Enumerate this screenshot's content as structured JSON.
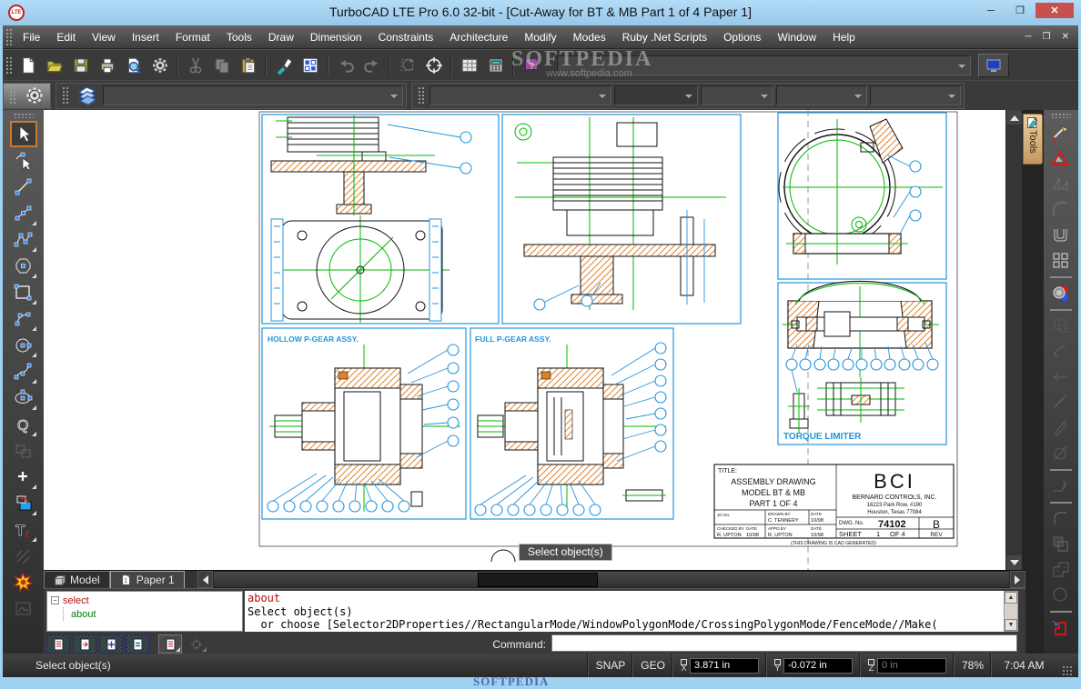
{
  "window": {
    "title": "TurboCAD LTE Pro 6.0 32-bit - [Cut-Away for BT & MB Part 1 of 4 Paper 1]",
    "app_badge": "LTE",
    "controls": {
      "minimize": "─",
      "maximize": "❐",
      "close": "✕"
    }
  },
  "watermark": {
    "line1": "SOFTPEDIA",
    "line2": "www.softpedia.com",
    "bottom": "SOFTPEDIA"
  },
  "menu_bar": {
    "items": [
      "File",
      "Edit",
      "View",
      "Insert",
      "Format",
      "Tools",
      "Draw",
      "Dimension",
      "Constraints",
      "Architecture",
      "Modify",
      "Modes",
      "Ruby .Net Scripts",
      "Options",
      "Window",
      "Help"
    ],
    "mdi_controls": [
      "─",
      "❐",
      "✕"
    ]
  },
  "toolbar_main": {
    "buttons": [
      {
        "name": "new-document"
      },
      {
        "name": "open-file"
      },
      {
        "name": "save"
      },
      {
        "name": "print"
      },
      {
        "name": "print-preview"
      },
      {
        "name": "settings-gear"
      },
      {
        "sep": true
      },
      {
        "name": "cut",
        "disabled": true
      },
      {
        "name": "copy",
        "disabled": true
      },
      {
        "name": "paste"
      },
      {
        "sep": true
      },
      {
        "name": "format-painter"
      },
      {
        "name": "selector-mode"
      },
      {
        "sep": true
      },
      {
        "name": "undo",
        "disabled": true
      },
      {
        "name": "redo",
        "disabled": true
      },
      {
        "sep": true
      },
      {
        "name": "rotate-selector",
        "disabled": true
      },
      {
        "name": "snap-target"
      },
      {
        "sep": true
      },
      {
        "name": "table"
      },
      {
        "name": "calculator"
      },
      {
        "sep": true
      },
      {
        "name": "help-book"
      }
    ],
    "combo_value": ""
  },
  "toolbar_properties": {
    "combos": [
      {
        "name": "layer-combo",
        "value": ""
      },
      {
        "name": "pen-style-combo",
        "value": ""
      },
      {
        "name": "pen-width-combo",
        "value": ""
      },
      {
        "name": "pen-pattern-combo",
        "value": ""
      },
      {
        "name": "brush-style-combo",
        "value": ""
      },
      {
        "name": "text-style-combo",
        "value": ""
      }
    ]
  },
  "left_toolbar": {
    "tools": [
      {
        "name": "select",
        "active": true
      },
      {
        "name": "edit-node"
      },
      {
        "name": "line"
      },
      {
        "name": "line-segment",
        "flyout": true
      },
      {
        "name": "polyline",
        "flyout": true
      },
      {
        "name": "polygon",
        "flyout": true
      },
      {
        "name": "rectangle",
        "flyout": true
      },
      {
        "name": "arc",
        "flyout": true
      },
      {
        "name": "circle",
        "flyout": true
      },
      {
        "name": "spline",
        "flyout": true
      },
      {
        "name": "ellipse",
        "flyout": true
      },
      {
        "name": "quick-curve",
        "flyout": true
      },
      {
        "name": "group",
        "disabled": true
      },
      {
        "name": "point",
        "flyout": true
      },
      {
        "name": "copy-transform",
        "flyout": true
      },
      {
        "name": "text",
        "flyout": true
      },
      {
        "name": "dimension",
        "disabled": true
      },
      {
        "name": "explode"
      },
      {
        "name": "insert-image",
        "disabled": true
      }
    ]
  },
  "right_toolbar": {
    "tab_label": "Tools",
    "tools": [
      {
        "name": "trim"
      },
      {
        "name": "delete-constraint"
      },
      {
        "name": "mirror",
        "disabled": true
      },
      {
        "name": "chamfer",
        "disabled": true
      },
      {
        "name": "offset"
      },
      {
        "name": "array"
      },
      {
        "sep": true
      },
      {
        "name": "render"
      },
      {
        "sep": true
      },
      {
        "name": "select-region",
        "disabled": true
      },
      {
        "name": "fillet",
        "disabled": true
      },
      {
        "name": "axis",
        "disabled": true
      },
      {
        "name": "measure",
        "disabled": true
      },
      {
        "name": "sketch",
        "disabled": true
      },
      {
        "name": "tangent",
        "disabled": true
      },
      {
        "sep": true
      },
      {
        "name": "extend",
        "disabled": true
      },
      {
        "sep": true
      },
      {
        "name": "round-corner",
        "disabled": true
      },
      {
        "name": "subtract",
        "disabled": true
      },
      {
        "name": "union",
        "disabled": true
      },
      {
        "name": "extrude",
        "disabled": true
      },
      {
        "sep": true
      },
      {
        "name": "profile"
      }
    ]
  },
  "canvas": {
    "tooltip": "Select object(s)",
    "drawing": {
      "hollow_label": "HOLLOW P-GEAR ASSY.",
      "full_label": "FULL P-GEAR ASSY.",
      "torque_label": "TORQUE LIMITER",
      "title_block": {
        "title_label": "TITLE:",
        "title_line1": "ASSEMBLY DRAWING",
        "title_line2": "MODEL BT & MB",
        "title_line3": "PART 1 OF 4",
        "jo_no": "JO No.",
        "drawn_by_label": "DRAWN BY",
        "drawn_by": "C. TENNERY",
        "drawn_date_label": "DATE",
        "drawn_date": "10/98",
        "checked_by_label": "CHECKED BY",
        "checked_by": "R. UPTON",
        "checked_date_label": "DATE",
        "checked_date": "10/98",
        "appd_by_label": "APPD BY",
        "appd_by": "R. UPTON",
        "appd_date_label": "DATE",
        "appd_date": "10/98",
        "logo": "BCI",
        "company": "BERNARD CONTROLS, INC.",
        "address1": "16223 Park Row, #190",
        "address2": "Houston, Texas  77084",
        "dwg_no_label": "DWG. No.",
        "dwg_no": "74102",
        "rev_value": "B",
        "sheet_label": "SHEET",
        "sheet_no": "1",
        "sheet_of": "OF 4",
        "rev_label": "REV",
        "caption": "(THIS DRAWING IS CAD GENERATED)"
      }
    }
  },
  "sheet_tabs": {
    "tabs": [
      {
        "label": "Model",
        "active": false
      },
      {
        "label": "Paper 1",
        "active": true
      }
    ]
  },
  "command_window": {
    "history_tree": {
      "root": "select",
      "child": "about"
    },
    "output_line1": "about",
    "output_line2": "Select object(s)",
    "output_line3": "  or choose [Selector2DProperties//RectangularMode/WindowPolygonMode/CrossingPolygonMode/FenceMode//Make(",
    "buttons": [
      {
        "name": "log-lines"
      },
      {
        "name": "log-jump"
      },
      {
        "name": "log-center"
      },
      {
        "name": "log-collapse"
      }
    ],
    "prompt_label": "Command:",
    "input_value": ""
  },
  "status_bar": {
    "message": "Select object(s)",
    "snap": "SNAP",
    "geo": "GEO",
    "x_label": "X",
    "x_value": "3.871 in",
    "y_label": "Y",
    "y_value": "-0.072 in",
    "z_label": "Z",
    "z_value": "0 in",
    "zoom": "78%",
    "time": "7:04 AM"
  },
  "colors": {
    "titlebar_blue": "#9fd1f1",
    "close_red": "#c75050",
    "drawing_blue": "#2494dc",
    "drawing_green": "#00b800",
    "hatch_orange": "#e0812a",
    "selection_orange": "#c8792e"
  }
}
